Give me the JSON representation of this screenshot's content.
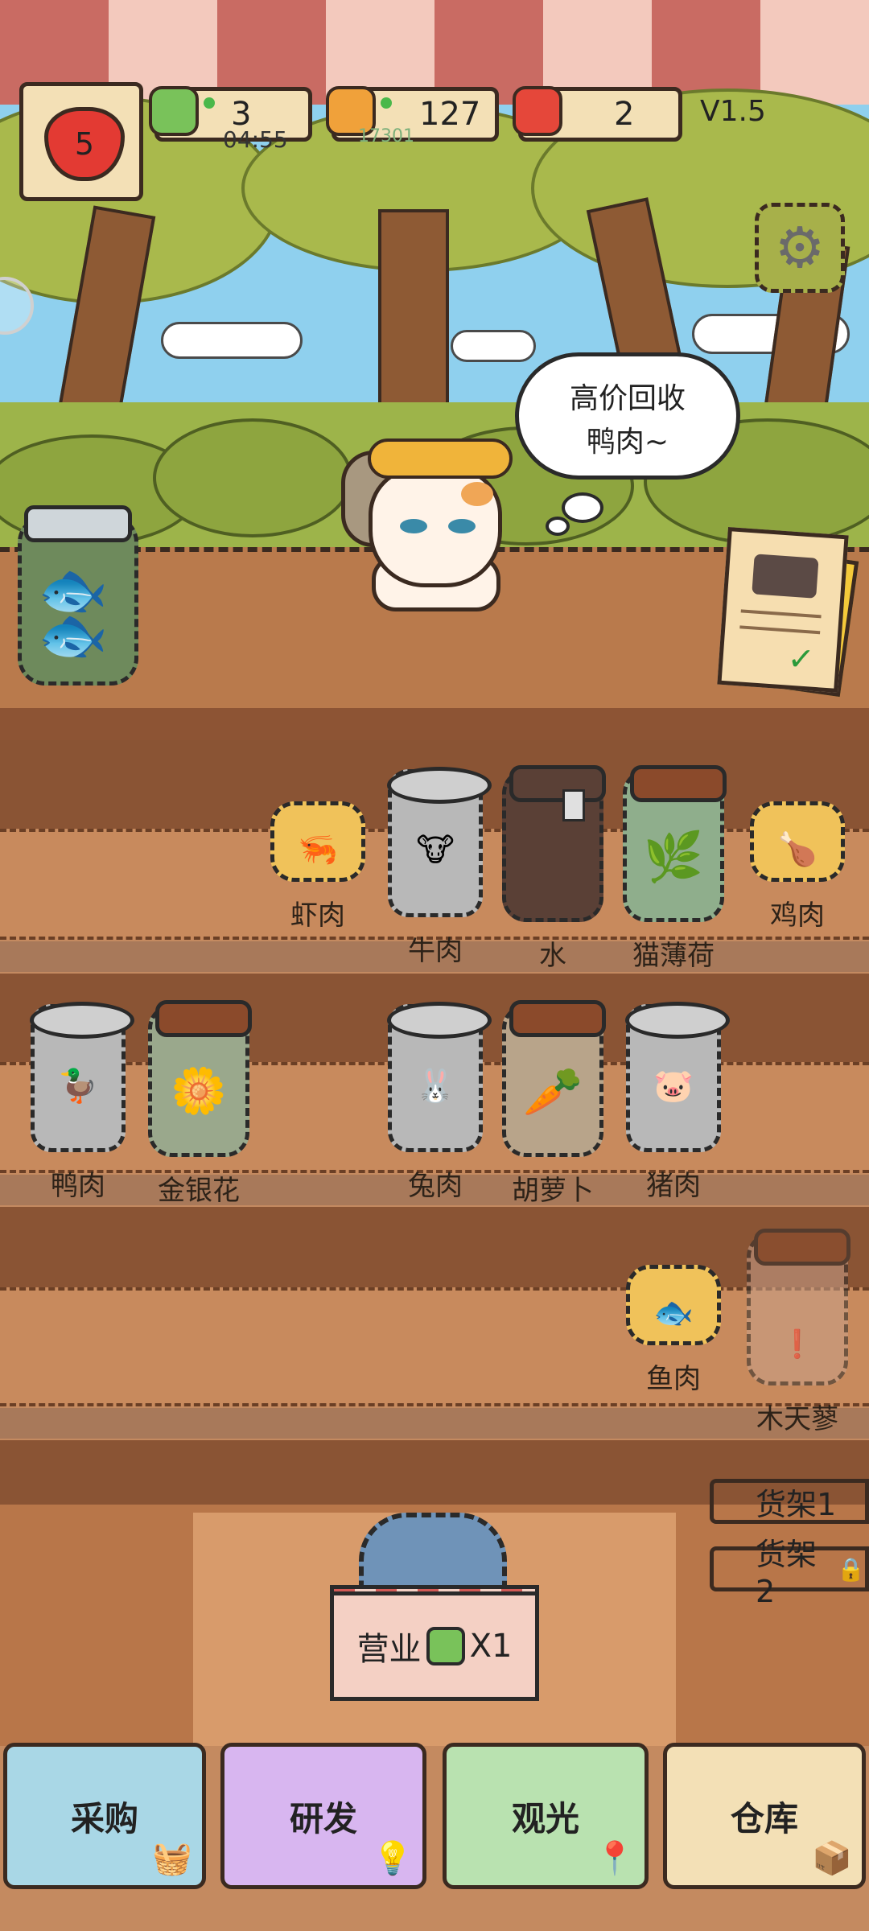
{
  "hud": {
    "hearts": "5",
    "energy": {
      "value": "3",
      "timer": "04:55"
    },
    "fish": {
      "value": "127",
      "sub": "17301"
    },
    "tickets": {
      "value": "2"
    },
    "version": "V1.5"
  },
  "speech": {
    "line1": "高价回收",
    "line2": "鸭肉~"
  },
  "shelf1": [
    {
      "label": "虾肉",
      "kind": "short",
      "icon": "shrimp-icon",
      "emoji": "🦐"
    },
    {
      "label": "牛肉",
      "kind": "tall",
      "icon": "cow-icon",
      "emoji": "🐮"
    },
    {
      "label": "水",
      "kind": "water",
      "icon": "water-icon",
      "emoji": ""
    },
    {
      "label": "猫薄荷",
      "kind": "jar-green",
      "icon": "catnip-icon",
      "emoji": "🌿"
    },
    {
      "label": "鸡肉",
      "kind": "short",
      "icon": "drumstick-icon",
      "emoji": "🍗"
    }
  ],
  "shelf2": [
    {
      "label": "鸭肉",
      "kind": "tall",
      "icon": "duck-icon",
      "emoji": "🦆"
    },
    {
      "label": "金银花",
      "kind": "jar-flower",
      "icon": "honeysuckle-icon",
      "emoji": "🌼"
    },
    {
      "label": "兔肉",
      "kind": "tall",
      "icon": "rabbit-icon",
      "emoji": "🐰"
    },
    {
      "label": "胡萝卜",
      "kind": "jar-carrot",
      "icon": "carrot-icon",
      "emoji": "🥕"
    },
    {
      "label": "猪肉",
      "kind": "tall",
      "icon": "pig-icon",
      "emoji": "🐷"
    }
  ],
  "shelf3": [
    {
      "label": "鱼肉",
      "kind": "short",
      "icon": "fish-icon",
      "emoji": "🐟"
    },
    {
      "label": "木天蓼",
      "kind": "jar-locked",
      "icon": "silvervine-icon",
      "emoji": "❗"
    }
  ],
  "racks": {
    "rack1": "货架1",
    "rack2": "货架2"
  },
  "open_sign": {
    "label": "营业",
    "multiplier": "X1"
  },
  "nav": {
    "purchase": "采购",
    "research": "研发",
    "sightseeing": "观光",
    "warehouse": "仓库"
  },
  "colors": {
    "nav_purchase": "#a9d7e6",
    "nav_research": "#d8b6f0",
    "nav_sightseeing": "#b9e2b0",
    "nav_warehouse": "#f3e0b6",
    "rack1": "#ec8a5c",
    "rack2": "#d8a27b"
  }
}
